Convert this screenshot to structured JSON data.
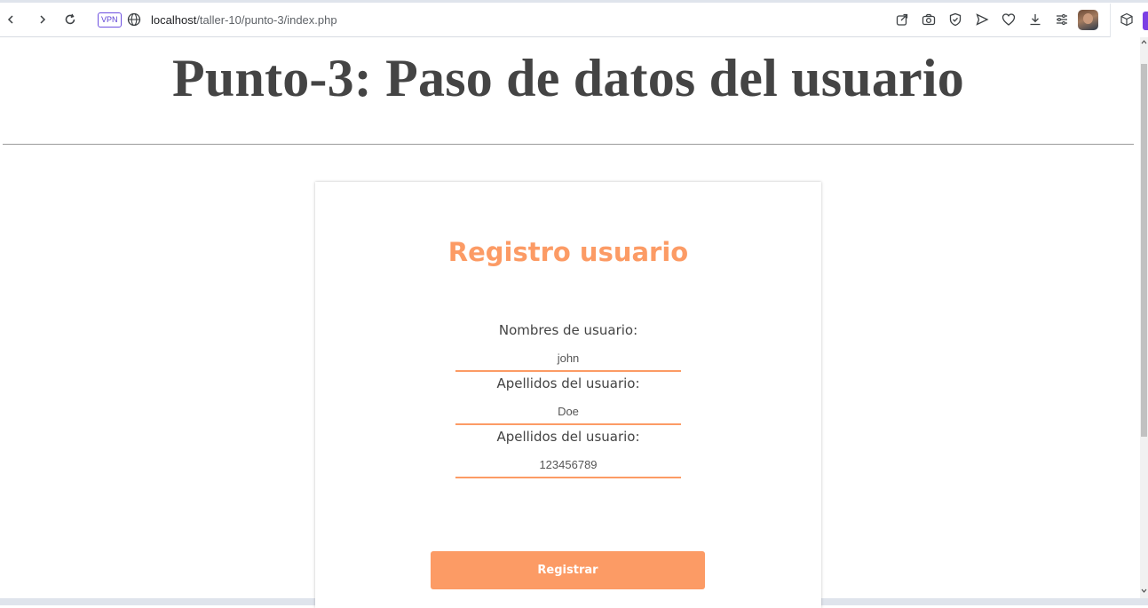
{
  "browser": {
    "url_host": "localhost",
    "url_path": "/taller-10/punto-3/index.php",
    "vpn_label": "VPN",
    "icons": [
      "back-icon",
      "forward-icon",
      "reload-icon",
      "globe-icon",
      "share-icon",
      "camera-icon",
      "shield-icon",
      "send-icon",
      "heart-icon",
      "download-icon",
      "menu-icon",
      "extension-box-icon"
    ]
  },
  "page": {
    "title": "Punto-3: Paso de datos del usuario"
  },
  "form": {
    "title": "Registro usuario",
    "fields": [
      {
        "label": "Nombres de usuario:",
        "value": "john"
      },
      {
        "label": "Apellidos del usuario:",
        "value": "Doe"
      },
      {
        "label": "Apellidos del usuario:",
        "value": "123456789"
      }
    ],
    "submit_label": "Registrar"
  },
  "colors": {
    "accent": "#fc9b65",
    "title_text": "#444444",
    "vpn": "#6c4fe0"
  }
}
